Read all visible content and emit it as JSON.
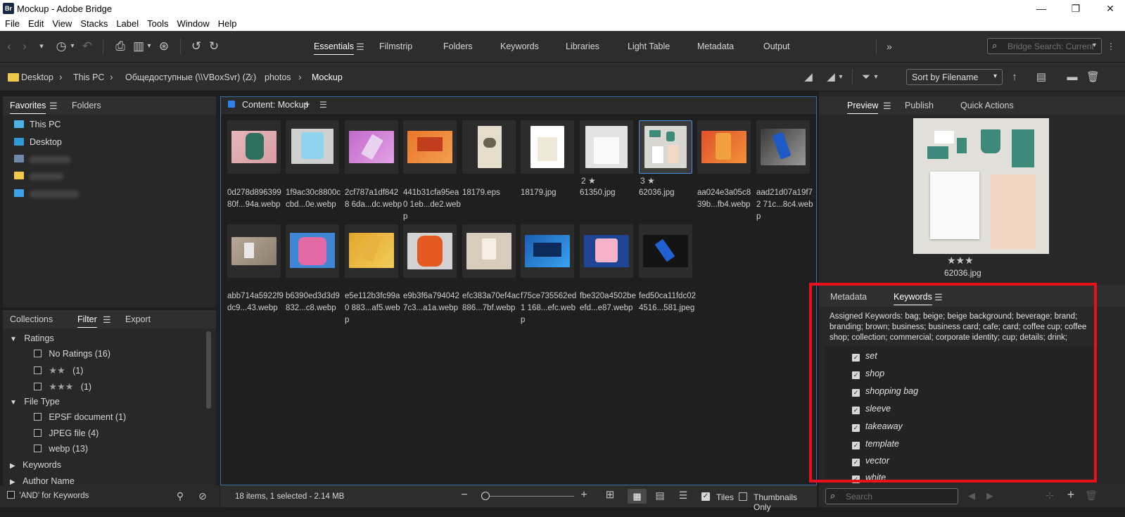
{
  "window": {
    "title": "Mockup - Adobe Bridge",
    "app_icon": "Br",
    "controls": [
      "—",
      "❐",
      "✕"
    ]
  },
  "menu": [
    "File",
    "Edit",
    "View",
    "Stacks",
    "Label",
    "Tools",
    "Window",
    "Help"
  ],
  "workspaces": [
    "Essentials",
    "Filmstrip",
    "Folders",
    "Keywords",
    "Libraries",
    "Light Table",
    "Metadata",
    "Output"
  ],
  "search": {
    "placeholder": "Bridge Search: Current"
  },
  "breadcrumb": [
    "Desktop",
    "This PC",
    "Общедоступные (\\\\VBoxSvr) (Z:)",
    "photos",
    "Mockup"
  ],
  "sort": {
    "label": "Sort by Filename"
  },
  "left_tabs": {
    "favorites": "Favorites",
    "folders": "Folders"
  },
  "favorites": [
    "This PC",
    "Desktop"
  ],
  "bottom_tabs": {
    "collections": "Collections",
    "filter": "Filter",
    "export": "Export"
  },
  "filter": {
    "ratings_label": "Ratings",
    "ratings": [
      {
        "label": "No Ratings",
        "count": "(16)",
        "stars": ""
      },
      {
        "label": "",
        "count": "(1)",
        "stars": "★★"
      },
      {
        "label": "",
        "count": "(1)",
        "stars": "★★★"
      }
    ],
    "filetype_label": "File Type",
    "filetypes": [
      {
        "label": "EPSF document",
        "count": "(1)"
      },
      {
        "label": "JPEG file",
        "count": "(4)"
      },
      {
        "label": "webp",
        "count": "(13)"
      }
    ],
    "keywords_label": "Keywords",
    "author_label": "Author Name"
  },
  "and_keywords": "'AND' for Keywords",
  "content": {
    "title": "Content: Mockup",
    "items": [
      {
        "name": "0d278d896399 80f...94a.webp",
        "stars": ""
      },
      {
        "name": "1f9ac30c8800c cbd...0e.webp",
        "stars": ""
      },
      {
        "name": "2cf787a1df8428 6da...dc.webp",
        "stars": ""
      },
      {
        "name": "441b31cfa95ea0 1eb...de2.webp",
        "stars": ""
      },
      {
        "name": "18179.eps",
        "stars": ""
      },
      {
        "name": "18179.jpg",
        "stars": ""
      },
      {
        "name": "61350.jpg",
        "stars": "2 ★"
      },
      {
        "name": "62036.jpg",
        "stars": "3 ★"
      },
      {
        "name": "aa024e3a05c8 39b...fb4.webp",
        "stars": ""
      },
      {
        "name": "aad21d07a19f72 71c...8c4.webp",
        "stars": ""
      },
      {
        "name": "abb714a5922f9 dc9...43.webp",
        "stars": ""
      },
      {
        "name": "b6390ed3d3d9 832...c8.webp",
        "stars": ""
      },
      {
        "name": "e5e112b3fc99a0 883...af5.webp",
        "stars": ""
      },
      {
        "name": "e9b3f6a794042 7c3...a1a.webp",
        "stars": ""
      },
      {
        "name": "efc383a70ef4ac 886...7bf.webp",
        "stars": ""
      },
      {
        "name": "f75ce735562ed1 168...efc.webp",
        "stars": ""
      },
      {
        "name": "fbe320a4502be efd...e87.webp",
        "stars": ""
      },
      {
        "name": "fed50ca11fdc02 4516...581.jpeg",
        "stars": ""
      }
    ]
  },
  "status": {
    "text": "18 items, 1 selected - 2.14 MB",
    "tiles": "Tiles",
    "thumbs_only": "Thumbnails Only"
  },
  "right_tabs": {
    "preview": "Preview",
    "publish": "Publish",
    "quick_actions": "Quick Actions"
  },
  "preview": {
    "stars": "★★★",
    "filename": "62036.jpg"
  },
  "meta_tabs": {
    "metadata": "Metadata",
    "keywords": "Keywords"
  },
  "assigned_keywords": "Assigned Keywords: bag; beige; beige background; beverage; brand; branding; brown; business; business card; cafe; card; coffee cup; coffee shop; collection; commercial; corporate identity; cup; details; drink; entrepreneur;",
  "keywords": [
    "set",
    "shop",
    "shopping bag",
    "sleeve",
    "takeaway",
    "template",
    "vector",
    "white"
  ],
  "kw_search": {
    "placeholder": "Search"
  }
}
